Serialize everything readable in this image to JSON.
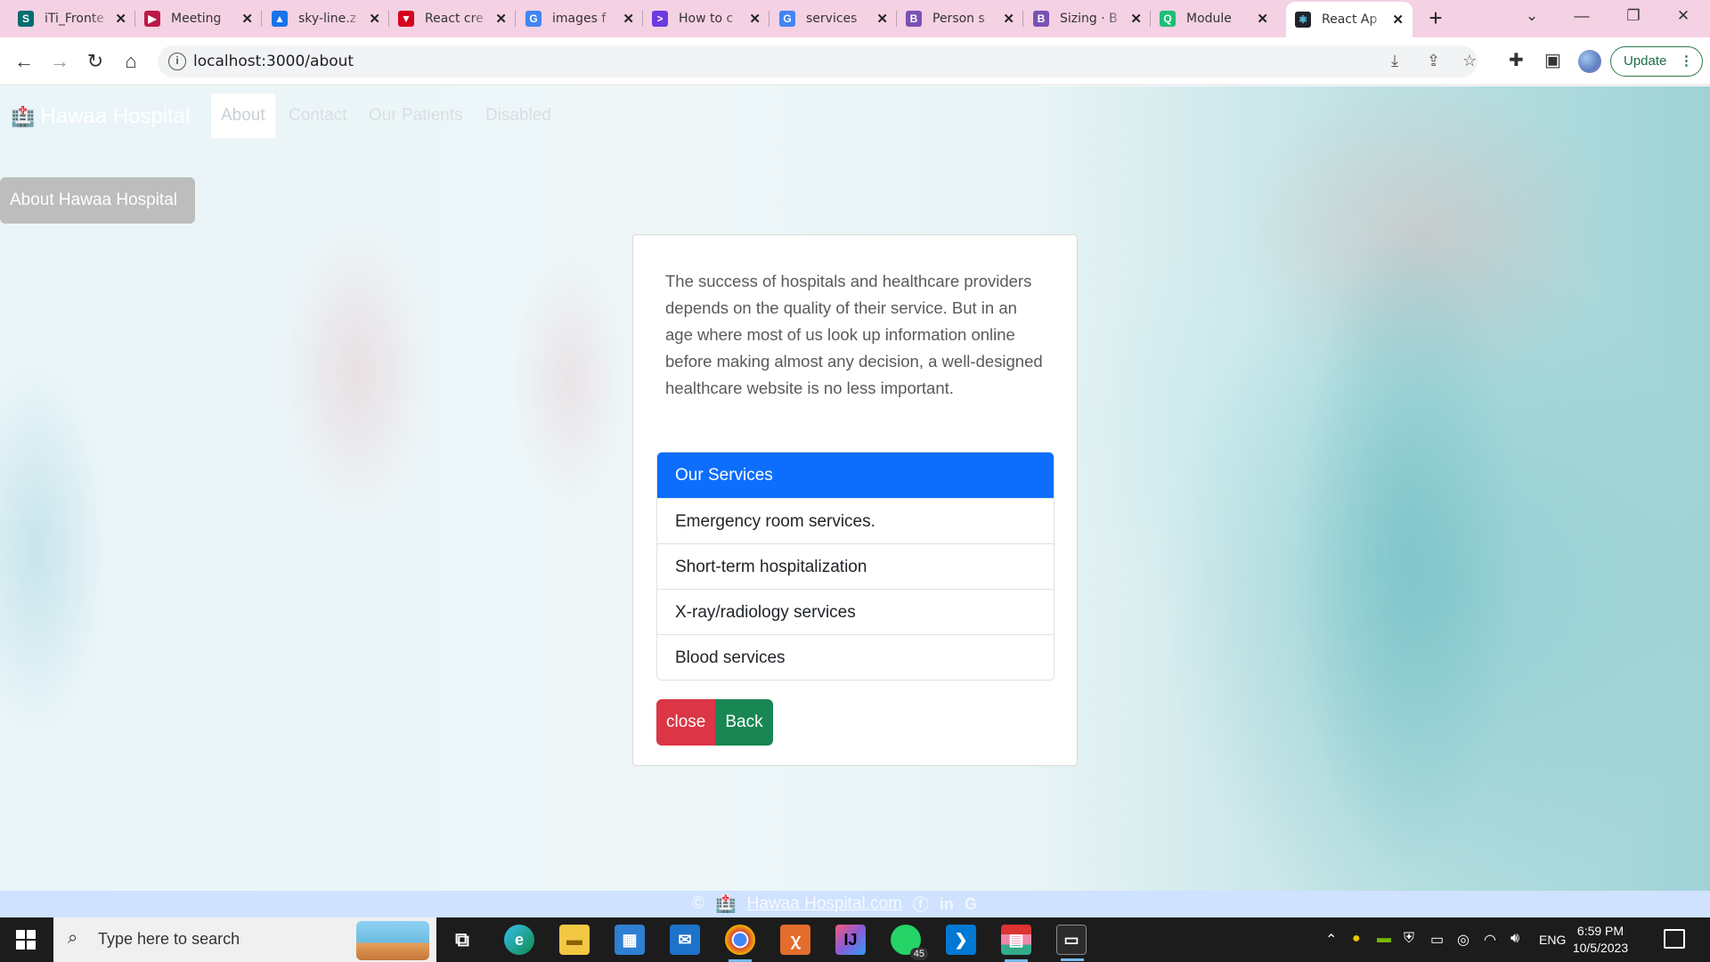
{
  "browser": {
    "tabs": [
      {
        "title": "iTi_Fronte",
        "icon": "sharepoint-icon",
        "color": "#036c70",
        "glyph": "S"
      },
      {
        "title": "Meeting",
        "icon": "stream-icon",
        "color": "#bc1948",
        "glyph": "▶"
      },
      {
        "title": "sky-line.z",
        "icon": "drive-icon",
        "color": "#1a73e8",
        "glyph": "▲"
      },
      {
        "title": "React cre",
        "icon": "vite-icon",
        "color": "#d6001c",
        "glyph": "▼"
      },
      {
        "title": "images f",
        "icon": "google-icon",
        "color": "#4285f4",
        "glyph": "G"
      },
      {
        "title": "How to c",
        "icon": "terminal-icon",
        "color": "#6c3be0",
        "glyph": ">"
      },
      {
        "title": "services",
        "icon": "google-icon",
        "color": "#4285f4",
        "glyph": "G"
      },
      {
        "title": "Person s",
        "icon": "bootstrap-icon",
        "color": "#7952b3",
        "glyph": "B"
      },
      {
        "title": "Sizing · B",
        "icon": "bootstrap-icon",
        "color": "#7952b3",
        "glyph": "B"
      },
      {
        "title": "Module",
        "icon": "devdocs-icon",
        "color": "#1dbf73",
        "glyph": "Q"
      },
      {
        "title": "React Ap",
        "icon": "react-icon",
        "color": "#20232a",
        "glyph": "⚛"
      }
    ],
    "new_tab": "+",
    "url": "localhost:3000/about",
    "update_label": "Update"
  },
  "navbar": {
    "brand": "Hawaa Hospital",
    "links": [
      "About",
      "Contact",
      "Our Patients",
      "Disabled"
    ]
  },
  "about_button": "About Hawaa Hospital",
  "card": {
    "text": "The success of hospitals and healthcare providers depends on the quality of their service. But in an age where most of us look up information online before making almost any decision, a well-designed healthcare website is no less important.",
    "list_header": "Our Services",
    "services": [
      "Emergency room services.",
      "Short-term hospitalization",
      "X-ray/radiology services",
      "Blood services"
    ],
    "close_label": "close",
    "back_label": "Back"
  },
  "footer": {
    "copyright": "©",
    "site_link": "Hawaa Hospital.com"
  },
  "taskbar": {
    "search_placeholder": "Type here to search",
    "whatsapp_badge": "45",
    "language": "ENG",
    "time": "6:59 PM",
    "date": "10/5/2023"
  },
  "colors": {
    "primary": "#0d6efd",
    "danger": "#dc3545",
    "success": "#198754",
    "tab_strip": "#f5d1e4",
    "footer": "#cfe2ff"
  }
}
